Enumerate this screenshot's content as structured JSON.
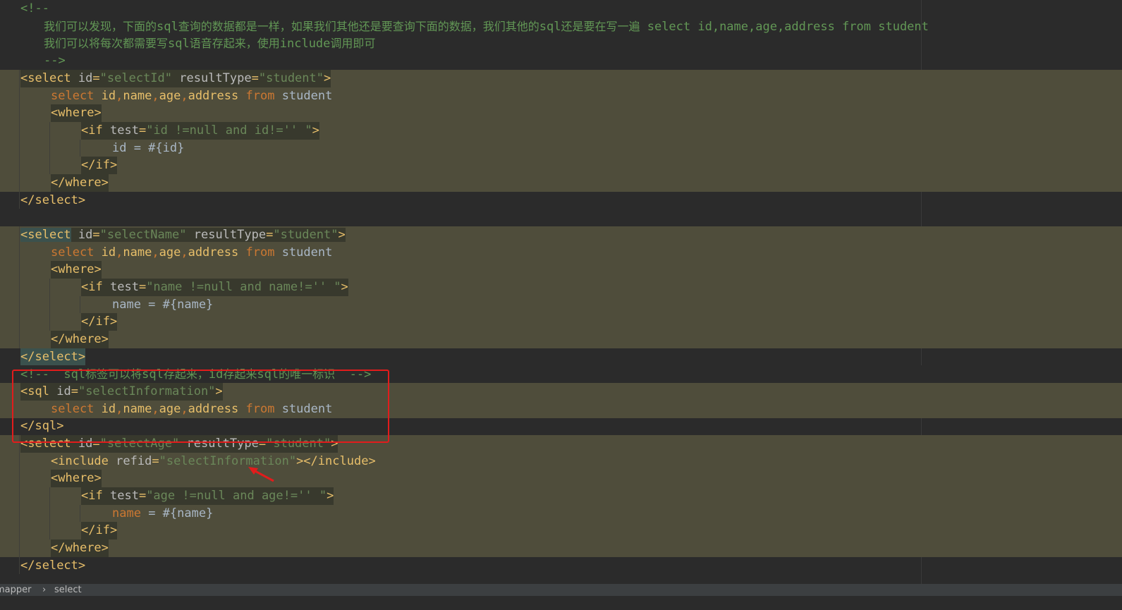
{
  "editor": {
    "comment_open": "<!--",
    "comment_line1_cn": "我们可以发现，下面的",
    "comment_line1_sql": "sql",
    "comment_line1_cn2": "查询的数据都是一样，如果我们其他还是要查询下面的数据，我们其他的",
    "comment_line1_sql2": "sql",
    "comment_line1_cn3": "还是要在写一遍",
    "comment_line1_tail": " select id,name,age,address from student",
    "comment_line2_cn": "我们可以将每次都需要写",
    "comment_line2_sql": "sql",
    "comment_line2_cn2": "语音存起来，使用",
    "comment_line2_inc": "include",
    "comment_line2_cn3": "调用即可",
    "comment_close": "-->",
    "select_tag": "select",
    "where_tag": "where",
    "if_tag": "if",
    "sql_tag": "sql",
    "include_tag": "include",
    "attr_id": "id",
    "attr_resultType": "resultType",
    "attr_test": "test",
    "attr_refid": "refid",
    "val_selectId": "\"selectId\"",
    "val_selectName": "\"selectName\"",
    "val_selectAge": "\"selectAge\"",
    "val_student": "\"student\"",
    "val_selectInformation": "\"selectInformation\"",
    "test_id": "\"id !=null and id!='' \"",
    "test_name": "\"name !=null and name!='' \"",
    "test_age": "\"age !=null and age!='' \"",
    "kw_select": "select",
    "kw_from": "from",
    "col_id": "id",
    "col_name": "name",
    "col_age": "age",
    "col_address": "address",
    "table_student": "student",
    "cond_id": "id = #{id}",
    "cond_name_kw": "name",
    "cond_name": "name = #{name}",
    "cond_name_rest": " = #{name}",
    "sql_comment_open": "<!--  ",
    "sql_comment_sql1": "sql",
    "sql_comment_cn1": "标签可以将",
    "sql_comment_sql2": "sql",
    "sql_comment_cn2": "存起来，",
    "sql_comment_id": "id",
    "sql_comment_cn3": "存起来",
    "sql_comment_sql3": "sql",
    "sql_comment_cn4": "的唯一标识",
    "sql_comment_close": "  -->"
  },
  "statusbar": {
    "crumb1": "mapper",
    "crumb_sep": "›",
    "crumb2": "select"
  },
  "colors": {
    "background": "#2b2b2b",
    "highlight": "#4f4d3b",
    "tag": "#e8bf6a",
    "attr_value": "#6a8759",
    "keyword": "#cc7832",
    "comment": "#629755",
    "annotation_box": "#e21c1c"
  },
  "icons": [
    "red-arrow-annotation-icon"
  ]
}
